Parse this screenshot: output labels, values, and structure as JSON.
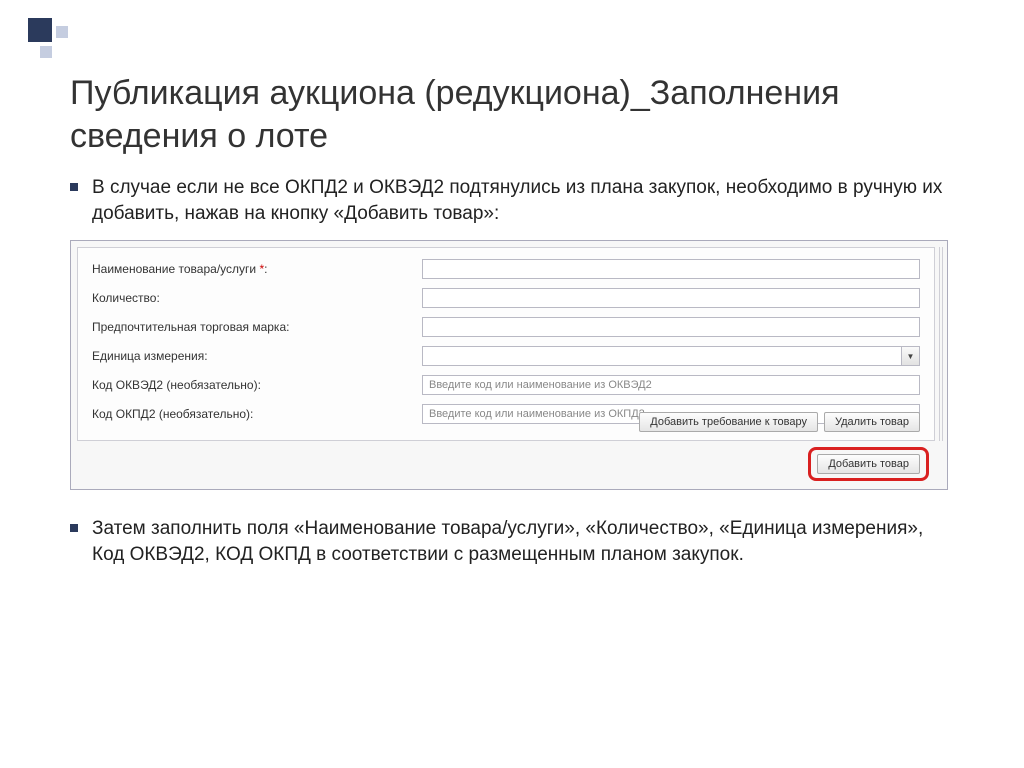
{
  "title": "Публикация аукциона (редукциона)_Заполнения сведения о лоте",
  "bullets": {
    "first": "В случае если не все ОКПД2 и ОКВЭД2 подтянулись из плана закупок, необходимо в ручную их добавить, нажав на кнопку «Добавить товар»:",
    "second": "Затем заполнить поля «Наименование товара/услуги», «Количество», «Единица измерения», Код ОКВЭД2, КОД ОКПД в соответствии с размещенным планом закупок."
  },
  "form": {
    "name_label": "Наименование товара/услуги",
    "name_required": "*",
    "colon": ":",
    "qty_label": "Количество:",
    "brand_label": "Предпочтительная торговая марка:",
    "unit_label": "Единица измерения:",
    "okved_label": "Код ОКВЭД2 (необязательно):",
    "okpd_label": "Код ОКПД2 (необязательно):",
    "okved_placeholder": "Введите код или наименование из ОКВЭД2",
    "okpd_placeholder": "Введите код или наименование из ОКПД2"
  },
  "buttons": {
    "add_requirement": "Добавить требование к товару",
    "delete_product": "Удалить товар",
    "add_product": "Добавить товар"
  }
}
